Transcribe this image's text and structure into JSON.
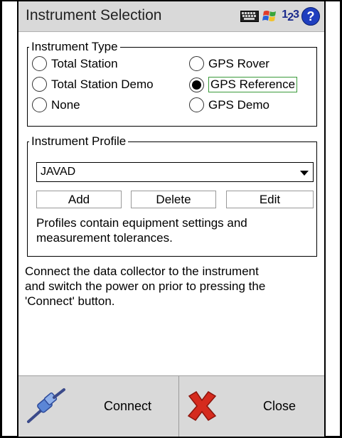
{
  "window": {
    "title": "Instrument Selection",
    "tray_number": "1",
    "tray_subscript": "2",
    "tray_number_tail": "3",
    "help_glyph": "?"
  },
  "instrument_type": {
    "legend": "Instrument Type",
    "options": [
      {
        "label": "Total Station",
        "selected": false
      },
      {
        "label": "Total Station Demo",
        "selected": false
      },
      {
        "label": "None",
        "selected": false
      },
      {
        "label": "GPS Rover",
        "selected": false
      },
      {
        "label": "GPS Reference",
        "selected": true
      },
      {
        "label": "GPS Demo",
        "selected": false
      }
    ]
  },
  "instrument_profile": {
    "legend": "Instrument Profile",
    "selected_value": "JAVAD",
    "buttons": {
      "add": "Add",
      "delete": "Delete",
      "edit": "Edit"
    },
    "note_line1": "Profiles contain equipment settings and",
    "note_line2": "measurement tolerances."
  },
  "instructions": {
    "line1": "Connect the data collector to the instrument",
    "line2": "and switch the power on prior to pressing the",
    "line3": "'Connect' button."
  },
  "bottom": {
    "connect_label": "Connect",
    "close_label": "Close"
  },
  "colors": {
    "titlebar": "#d9d9d9",
    "help_icon": "#1f3fbf",
    "close_x": "#d52b1e",
    "connect_icon": "#4a70c8",
    "focus_border": "#3a9a3a"
  }
}
